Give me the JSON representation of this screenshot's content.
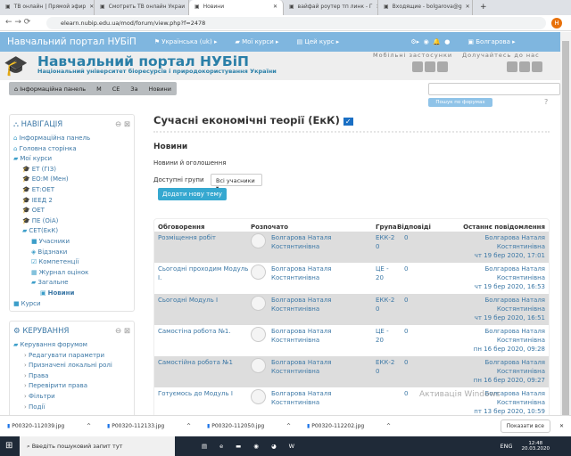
{
  "browser": {
    "tabs": [
      {
        "label": "ТВ онлайн | Прямой эфир",
        "active": false
      },
      {
        "label": "Смотреть ТВ онлайн Украи",
        "active": false
      },
      {
        "label": "Новини",
        "active": true
      },
      {
        "label": "вайфай роутер тп линк - Г",
        "active": false
      },
      {
        "label": "Входящие - bolgarova@g",
        "active": false
      }
    ],
    "url": "elearn.nubip.edu.ua/mod/forum/view.php?f=2478",
    "profile_initial": "Н"
  },
  "navbar": {
    "brand": "Навчальний портал НУБіП",
    "language": "Українська (uk)",
    "my_courses": "Мої курси",
    "this_course": "Цей курс",
    "user": "Болгарова"
  },
  "header": {
    "title": "Навчальний портал НУБіП",
    "subtitle": "Національний університет біоресурсів і природокористування України",
    "mobile": "Мобільні застосунки",
    "join": "Долучайтесь до нас"
  },
  "breadcrumb": [
    "Інформаційна панель",
    "М",
    "СЕ",
    "За",
    "Новини"
  ],
  "search": {
    "button": "Пошук по форумах"
  },
  "navigation": {
    "title": "НАВІГАЦІЯ",
    "items": [
      {
        "label": "Інформаційна панель",
        "level": 0,
        "icon": "home"
      },
      {
        "label": "Головна сторінка",
        "level": 0,
        "icon": "home"
      },
      {
        "label": "Мої курси",
        "level": 0,
        "icon": "folder-open"
      },
      {
        "label": "ЕТ (ГІЗ)",
        "level": 1,
        "icon": "grad-cap"
      },
      {
        "label": "ЕО:М (Мен)",
        "level": 1,
        "icon": "grad-cap"
      },
      {
        "label": "ЕТ:ОЕТ",
        "level": 1,
        "icon": "grad-cap"
      },
      {
        "label": "ІЕЕД 2",
        "level": 1,
        "icon": "grad-cap"
      },
      {
        "label": "ОЕТ",
        "level": 1,
        "icon": "grad-cap"
      },
      {
        "label": "ПЕ (ОіА)",
        "level": 1,
        "icon": "grad-cap"
      },
      {
        "label": "СЕТ(ЕкК)",
        "level": 1,
        "icon": "folder-open"
      },
      {
        "label": "Учасники",
        "level": 2,
        "icon": "folder"
      },
      {
        "label": "Відзнаки",
        "level": 2,
        "icon": "shield"
      },
      {
        "label": "Компетенції",
        "level": 2,
        "icon": "checkbox"
      },
      {
        "label": "Журнал оцінок",
        "level": 2,
        "icon": "table"
      },
      {
        "label": "Загальне",
        "level": 2,
        "icon": "folder-open"
      },
      {
        "label": "Новини",
        "level": 3,
        "icon": "forum"
      },
      {
        "label": "Курси",
        "level": 0,
        "icon": "folder"
      }
    ]
  },
  "management": {
    "title": "КЕРУВАННЯ",
    "root": "Керування форумом",
    "items": [
      "Редагувати параметри",
      "Призначені локальні ролі",
      "Права",
      "Перевірити права",
      "Фільтри",
      "Події"
    ]
  },
  "main": {
    "course_title": "Сучасні економічні теорії (ЕкК)",
    "forum_title": "Новини",
    "description": "Новини й оголошення",
    "groups_label": "Доступні групи",
    "groups_value": "Всі учасники",
    "add_button": "Додати нову тему"
  },
  "table": {
    "headers": [
      "Обговорення",
      "Розпочато",
      "Група",
      "Відповіді",
      "Останнє повідомлення"
    ],
    "rows": [
      {
        "topic": "Розміщення робіт",
        "author": "Болгарова Наталя Костянтинівна",
        "group": "ЕКК-2 0",
        "replies": "0",
        "last_author": "Болгарова Наталя Костянтинівна",
        "last_date": "чт 19 бер 2020, 17:01"
      },
      {
        "topic": "Сьогодні проходим Модуль І.",
        "author": "Болгарова Наталя Костянтинівна",
        "group": "ЦЕ - 20",
        "replies": "0",
        "last_author": "Болгарова Наталя Костянтинівна",
        "last_date": "чт 19 бер 2020, 16:53"
      },
      {
        "topic": "Сьогодні Модуль І",
        "author": "Болгарова Наталя Костянтинівна",
        "group": "ЕКК-2 0",
        "replies": "0",
        "last_author": "Болгарова Наталя Костянтинівна",
        "last_date": "чт 19 бер 2020, 16:51"
      },
      {
        "topic": "Самостіна робота №1.",
        "author": "Болгарова Наталя Костянтинівна",
        "group": "ЦЕ - 20",
        "replies": "0",
        "last_author": "Болгарова Наталя Костянтинівна",
        "last_date": "пн 16 бер 2020, 09:28"
      },
      {
        "topic": "Самостійна робота №1",
        "author": "Болгарова Наталя Костянтинівна",
        "group": "ЕКК-2 0",
        "replies": "0",
        "last_author": "Болгарова Наталя Костянтинівна",
        "last_date": "пн 16 бер 2020, 09:27"
      },
      {
        "topic": "Готуємось до Модуль І",
        "author": "Болгарова Наталя Костянтинівна",
        "group": "",
        "replies": "0",
        "last_author": "Болгарова Наталя Костянтинівна",
        "last_date": "пт 13 бер 2020, 10:59"
      }
    ]
  },
  "downloads": {
    "files": [
      "P00320-112039.jpg",
      "P00320-112133.jpg",
      "P00320-112050.jpg",
      "P00320-112202.jpg"
    ],
    "show_all": "Показати все"
  },
  "taskbar": {
    "search_placeholder": "Введіть пошуковий запит тут",
    "lang": "ENG",
    "time": "12:48",
    "date": "20.03.2020"
  }
}
